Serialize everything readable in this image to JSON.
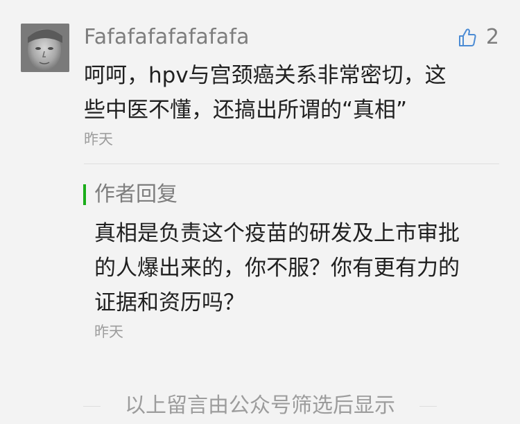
{
  "comment": {
    "username": "Fafafafafafafafa",
    "like_icon": "thumbs-up-icon",
    "like_count": "2",
    "text_lines": [
      "呵呵，hpv与宫颈癌关系非常密切，这",
      "些中医不懂，还搞出所谓的“真相”"
    ],
    "time": "昨天"
  },
  "author_reply": {
    "label": "作者回复",
    "accent_color": "#1aad19",
    "text_lines": [
      "真相是负责这个疫苗的研发及上市审批",
      "的人爆出来的，你不服？你有更有力的",
      "证据和资历吗？"
    ],
    "time": "昨天"
  },
  "footer": {
    "text": "以上留言由公众号筛选后显示"
  }
}
